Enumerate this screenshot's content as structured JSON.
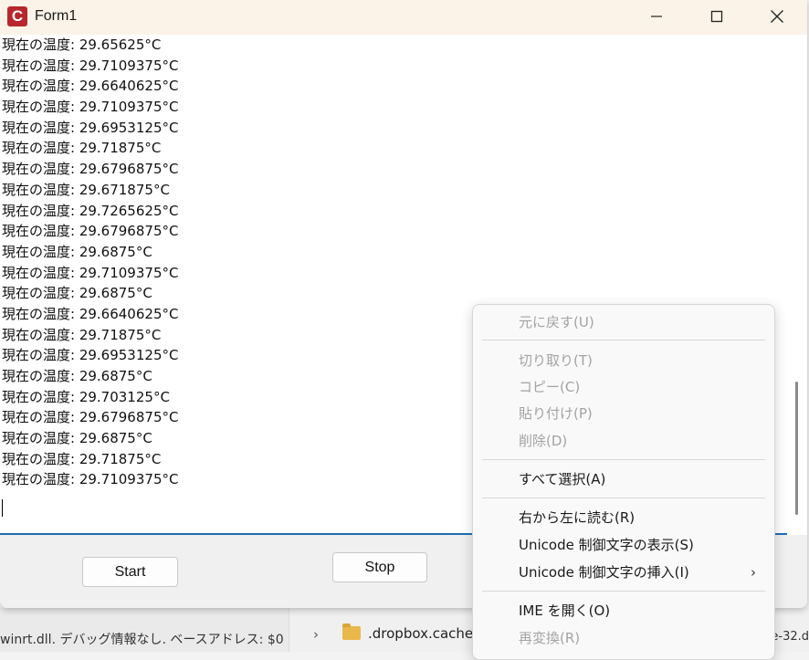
{
  "window": {
    "title": "Form1",
    "app_icon_letter": "C"
  },
  "log_lines": [
    "現在の温度: 29.65625°C",
    "現在の温度: 29.7109375°C",
    "現在の温度: 29.6640625°C",
    "現在の温度: 29.7109375°C",
    "現在の温度: 29.6953125°C",
    "現在の温度: 29.71875°C",
    "現在の温度: 29.6796875°C",
    "現在の温度: 29.671875°C",
    "現在の温度: 29.7265625°C",
    "現在の温度: 29.6796875°C",
    "現在の温度: 29.6875°C",
    "現在の温度: 29.7109375°C",
    "現在の温度: 29.6875°C",
    "現在の温度: 29.6640625°C",
    "現在の温度: 29.71875°C",
    "現在の温度: 29.6953125°C",
    "現在の温度: 29.6875°C",
    "現在の温度: 29.703125°C",
    "現在の温度: 29.6796875°C",
    "現在の温度: 29.6875°C",
    "現在の温度: 29.71875°C",
    "現在の温度: 29.7109375°C"
  ],
  "buttons": {
    "start": "Start",
    "stop": "Stop"
  },
  "context_menu": {
    "undo": "元に戻す(U)",
    "cut": "切り取り(T)",
    "copy": "コピー(C)",
    "paste": "貼り付け(P)",
    "delete": "削除(D)",
    "select_all": "すべて選択(A)",
    "rtl": "右から左に読む(R)",
    "show_unicode": "Unicode 制御文字の表示(S)",
    "insert_unicode": "Unicode 制御文字の挿入(I)",
    "submenu_arrow": "›",
    "open_ime": "IME を開く(O)",
    "reconvert": "再変換(R)"
  },
  "background": {
    "debug_text": "winrt.dll. デバッグ情報なし. ベースアドレス: $0",
    "folder_name": ".dropbox.cache",
    "right_text": "e-32.d",
    "tree_chevron": "›"
  }
}
